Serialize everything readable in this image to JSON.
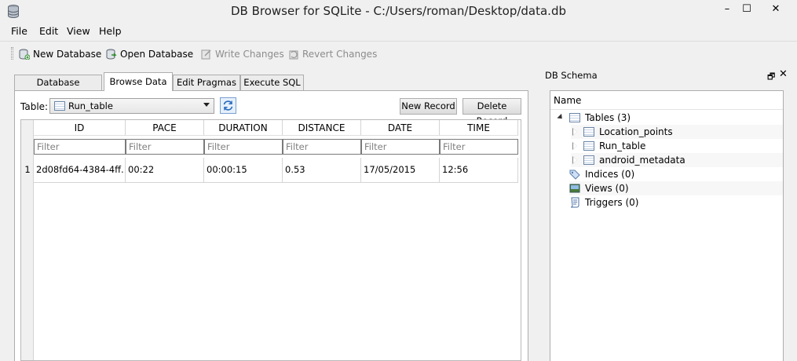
{
  "window": {
    "title": "DB Browser for SQLite - C:/Users/roman/Desktop/data.db",
    "min": "–",
    "max": "☐",
    "close": "✕"
  },
  "menu": [
    "File",
    "Edit",
    "View",
    "Help"
  ],
  "toolbar": {
    "new_db": "New Database",
    "open_db": "Open Database",
    "write": "Write Changes",
    "revert": "Revert Changes"
  },
  "tabs": [
    "Database Structure",
    "Browse Data",
    "Edit Pragmas",
    "Execute SQL"
  ],
  "browse": {
    "table_label": "Table:",
    "table_value": "Run_table",
    "new_record": "New Record",
    "delete_record": "Delete Record",
    "columns": [
      "ID",
      "PACE",
      "DURATION",
      "DISTANCE",
      "DATE",
      "TIME"
    ],
    "filter_placeholder": "Filter",
    "rows": [
      {
        "num": "1",
        "cells": [
          "2d08fd64-4384-4ff...",
          "00:22",
          "00:00:15",
          "0.53",
          "17/05/2015",
          "12:56"
        ]
      }
    ]
  },
  "schema": {
    "title": "DB Schema",
    "float": "🗗",
    "close": "✕",
    "header": "Name",
    "tables": "Tables (3)",
    "table_items": [
      "Location_points",
      "Run_table",
      "android_metadata"
    ],
    "indices": "Indices (0)",
    "views": "Views (0)",
    "triggers": "Triggers (0)"
  },
  "colors": {
    "accent": "#7aa0d0",
    "background": "#f0f0f0",
    "disabled_text": "#8c8c8c"
  }
}
